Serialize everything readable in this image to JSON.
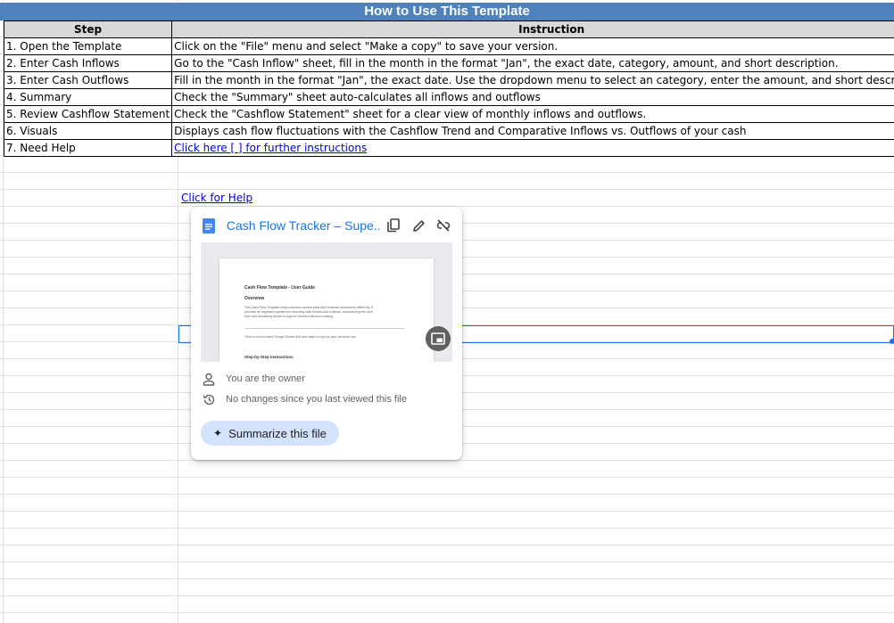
{
  "header": {
    "title": "How to Use This Template"
  },
  "table": {
    "columns": [
      "Step",
      "Instruction"
    ],
    "rows": [
      {
        "step": "1. Open the Template",
        "instruction": "Click on the \"File\" menu and select \"Make a copy\" to save your version."
      },
      {
        "step": "2. Enter Cash Inflows",
        "instruction": "Go to the \"Cash Inflow\" sheet, fill in the month in the format \"Jan\", the exact date, category, amount, and short description."
      },
      {
        "step": "3. Enter Cash Outflows",
        "instruction": "Fill in the month in the format \"Jan\", the exact date.  Use the dropdown menu to select an category, enter the amount, and short description."
      },
      {
        "step": "4.  Summary",
        "instruction": "Check the \"Summary\" sheet auto-calculates all inflows and outflows"
      },
      {
        "step": "5. Review Cashflow Statement",
        "instruction": "Check the \"Cashflow Statement\" sheet for a clear view of monthly inflows and outflows."
      },
      {
        "step": "6. Visuals",
        "instruction": "Displays cash flow fluctuations with the Cashflow Trend and Comparative Inflows vs. Outflows of your cash"
      },
      {
        "step": "7. Need Help",
        "instruction": "Click here [     ] for further instructions"
      }
    ]
  },
  "help_link": "Click for Help",
  "popup": {
    "file_title": "Cash Flow Tracker – Supe...",
    "preview": {
      "doc_title": "Cash Flow Template - User Guide",
      "overview_heading": "Overview",
      "overview_text_1": "This Cash Flow Template helps business owners track their financial movements efficiently. It",
      "overview_text_2": "provides an organized system for recording cash inflows and outflows, summarizing net cash",
      "overview_text_3": "flow, and visualizing trends to support informed decision-making.",
      "step_text": "Click on the provided Google Sheets link and make a copy for your personal use.",
      "steps_heading": "Step-by-Step Instructions"
    },
    "owner_text": "You are the owner",
    "changes_text": "No changes since you last viewed this file",
    "summarize_label": "Summarize this file",
    "colors": {
      "link": "#1a73e8",
      "button_bg": "#d3e3fd",
      "header_bg": "#4f81bd"
    }
  }
}
